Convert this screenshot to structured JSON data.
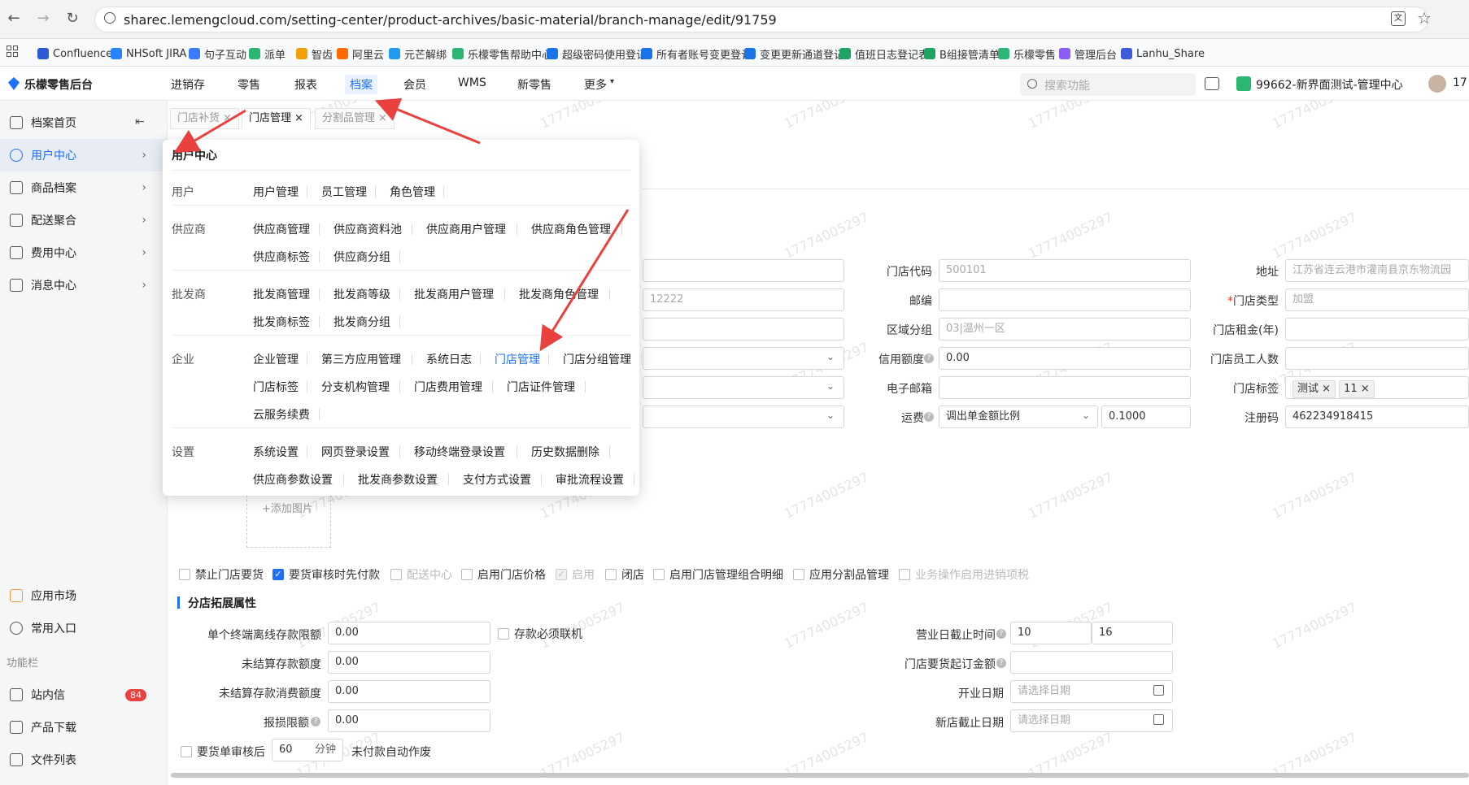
{
  "browser": {
    "url": "sharec.lemengcloud.com/setting-center/product-archives/basic-material/branch-manage/edit/91759"
  },
  "bookmarks": [
    {
      "label": "Confluence",
      "color": "#2d5bd8"
    },
    {
      "label": "NHSoft JIRA",
      "color": "#2684ff"
    },
    {
      "label": "句子互动",
      "color": "#3a7bfd"
    },
    {
      "label": "派单",
      "color": "#2bb673"
    },
    {
      "label": "智齿",
      "color": "#f2a007"
    },
    {
      "label": "阿里云",
      "color": "#ff6a00"
    },
    {
      "label": "元芒解绑",
      "color": "#1f9cf0"
    },
    {
      "label": "乐檬零售帮助中心",
      "color": "#2bb673"
    },
    {
      "label": "超级密码使用登记",
      "color": "#1a73e8"
    },
    {
      "label": "所有者账号变更登记",
      "color": "#1a73e8"
    },
    {
      "label": "变更更新通道登记",
      "color": "#1a73e8"
    },
    {
      "label": "值班日志登记表",
      "color": "#1ea362"
    },
    {
      "label": "B组接管清单",
      "color": "#1ea362"
    },
    {
      "label": "乐檬零售",
      "color": "#2bb673"
    },
    {
      "label": "管理后台",
      "color": "#8b5cf6"
    },
    {
      "label": "Lanhu_Share",
      "color": "#3b5bdb"
    }
  ],
  "app": {
    "logo": "乐檬零售后台",
    "accent": "#1f6fff"
  },
  "topnav": {
    "items": [
      "进销存",
      "零售",
      "报表",
      "档案",
      "会员",
      "WMS",
      "新零售",
      "更多"
    ],
    "active": "档案",
    "search_placeholder": "搜索功能",
    "store": "99662-新界面测试-管理中心",
    "user": "17"
  },
  "sidebar": {
    "items": [
      "档案首页",
      "用户中心",
      "商品档案",
      "配送聚合",
      "费用中心",
      "消息中心"
    ],
    "bottom": [
      "应用市场",
      "常用入口"
    ],
    "section": "功能栏",
    "tools": [
      "站内信",
      "产品下载",
      "文件列表"
    ],
    "badge": "84"
  },
  "tabs": [
    {
      "label": "门店补货"
    },
    {
      "label": "门店管理"
    },
    {
      "label": "分割品管理"
    }
  ],
  "form": {
    "store_code_label": "门店代码",
    "store_code": "500101",
    "address_label": "地址",
    "address": "江苏省连云港市灌南县京东物流园",
    "postcode_label": "邮编",
    "store_type_label": "门店类型",
    "store_type": "加盟",
    "region_label": "区域分组",
    "region": "03|温州一区",
    "rent_label": "门店租金(年)",
    "credit_label": "信用额度",
    "credit": "0.00",
    "staff_label": "门店员工人数",
    "email_label": "电子邮箱",
    "tags_label": "门店标签",
    "tags": [
      "测试",
      "11"
    ],
    "freight_label": "运费",
    "freight_mode": "调出单金额比例",
    "freight_value": "0.1000",
    "reg_label": "注册码",
    "reg": "462234918415",
    "phone_partial": "12222",
    "add_image": "+添加图片"
  },
  "checkboxes": [
    {
      "label": "禁止门店要货",
      "checked": false,
      "disabled": false
    },
    {
      "label": "要货审核时先付款",
      "checked": true,
      "disabled": false
    },
    {
      "label": "配送中心",
      "checked": false,
      "disabled": true
    },
    {
      "label": "启用门店价格",
      "checked": false,
      "disabled": false
    },
    {
      "label": "启用",
      "checked": true,
      "disabled": true
    },
    {
      "label": "闭店",
      "checked": false,
      "disabled": false
    },
    {
      "label": "启用门店管理组合明细",
      "checked": false,
      "disabled": false
    },
    {
      "label": "应用分割品管理",
      "checked": false,
      "disabled": false
    },
    {
      "label": "业务操作启用进销项税",
      "checked": false,
      "disabled": true
    }
  ],
  "ext": {
    "title": "分店拓展属性",
    "offline_label": "单个终端离线存款限额",
    "offline": "0.00",
    "must_online": "存款必须联机",
    "unsettled_label": "未结算存款额度",
    "unsettled": "0.00",
    "unsettled_consume_label": "未结算存款消费额度",
    "unsettled_consume": "0.00",
    "loss_label": "报损限额",
    "loss": "0.00",
    "biz_end_label": "营业日截止时间",
    "biz_end_h": "10",
    "biz_end_m": "16",
    "min_order_label": "门店要货起订金额",
    "open_date_label": "开业日期",
    "date_placeholder": "请选择日期",
    "new_end_label": "新店截止日期",
    "auto_label1": "要货单审核后",
    "auto_minutes": "60",
    "auto_unit": "分钟",
    "auto_label2": "未付款自动作废"
  },
  "popup": {
    "title": "用户中心",
    "groups": [
      {
        "cat": "用户",
        "rows": [
          [
            "用户管理",
            "员工管理",
            "角色管理"
          ]
        ]
      },
      {
        "cat": "供应商",
        "rows": [
          [
            "供应商管理",
            "供应商资料池",
            "供应商用户管理",
            "供应商角色管理"
          ],
          [
            "供应商标签",
            "供应商分组"
          ]
        ]
      },
      {
        "cat": "批发商",
        "rows": [
          [
            "批发商管理",
            "批发商等级",
            "批发商用户管理",
            "批发商角色管理"
          ],
          [
            "批发商标签",
            "批发商分组"
          ]
        ]
      },
      {
        "cat": "企业",
        "rows": [
          [
            "企业管理",
            "第三方应用管理",
            "系统日志",
            "门店管理",
            "门店分组管理"
          ],
          [
            "门店标签",
            "分支机构管理",
            "门店费用管理",
            "门店证件管理"
          ],
          [
            "云服务续费"
          ]
        ]
      },
      {
        "cat": "设置",
        "rows": [
          [
            "系统设置",
            "网页登录设置",
            "移动终端登录设置",
            "历史数据删除"
          ],
          [
            "供应商参数设置",
            "批发商参数设置",
            "支付方式设置",
            "审批流程设置"
          ]
        ]
      }
    ],
    "active_link": "门店管理"
  },
  "watermark": "17774005297"
}
